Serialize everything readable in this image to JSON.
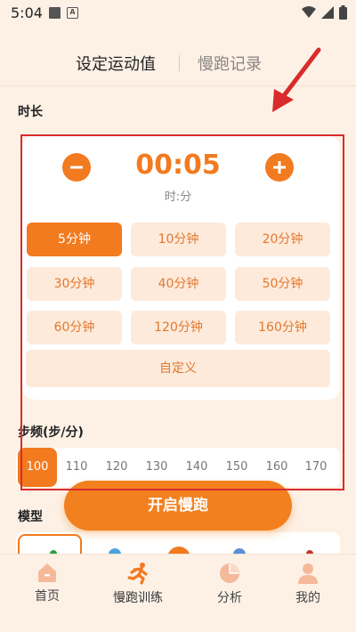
{
  "status_bar": {
    "time": "5:04"
  },
  "header": {
    "tab_active": "设定运动值",
    "tab_other": "慢跑记录"
  },
  "duration": {
    "label": "时长",
    "value": "00:05",
    "unit": "时:分",
    "options": [
      "5分钟",
      "10分钟",
      "20分钟",
      "30分钟",
      "40分钟",
      "50分钟",
      "60分钟",
      "120分钟",
      "160分钟"
    ],
    "selected": "5分钟",
    "custom_label": "自定义"
  },
  "cadence": {
    "label": "步频(步/分)",
    "values": [
      "100",
      "110",
      "120",
      "130",
      "140",
      "150",
      "160",
      "170"
    ],
    "selected": "100"
  },
  "start_button": "开启慢跑",
  "model": {
    "label": "模型"
  },
  "bottom_nav": {
    "items": [
      "首页",
      "慢跑训练",
      "分析",
      "我的"
    ],
    "active": "慢跑训练"
  },
  "colors": {
    "accent": "#f27a1f",
    "background": "#fdf1e6",
    "annotation": "#d92b2b"
  }
}
